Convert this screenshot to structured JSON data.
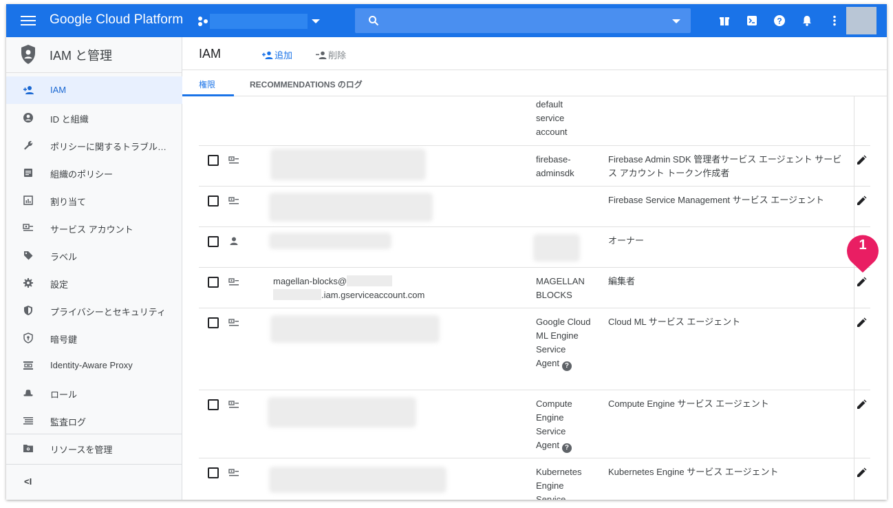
{
  "topbar": {
    "brand": "Google Cloud Platform",
    "icons": [
      "menu-icon",
      "project-icon",
      "search-icon",
      "gift-icon",
      "cloud-shell-icon",
      "help-icon",
      "notifications-icon",
      "more-icon"
    ]
  },
  "sidebar": {
    "title": "IAM と管理",
    "items": [
      {
        "label": "IAM",
        "icon": "add-person-icon",
        "active": true
      },
      {
        "label": "ID と組織",
        "icon": "account-circle-icon"
      },
      {
        "label": "ポリシーに関するトラブル…",
        "icon": "wrench-icon"
      },
      {
        "label": "組織のポリシー",
        "icon": "list-icon"
      },
      {
        "label": "割り当て",
        "icon": "quota-icon"
      },
      {
        "label": "サービス アカウント",
        "icon": "service-account-icon"
      },
      {
        "label": "ラベル",
        "icon": "label-icon"
      },
      {
        "label": "設定",
        "icon": "gear-icon"
      },
      {
        "label": "プライバシーとセキュリティ",
        "icon": "shield-icon"
      },
      {
        "label": "暗号鍵",
        "icon": "key-shield-icon"
      },
      {
        "label": "Identity-Aware Proxy",
        "icon": "proxy-icon"
      },
      {
        "label": "ロール",
        "icon": "hat-icon"
      },
      {
        "label": "監査ログ",
        "icon": "audit-icon"
      }
    ],
    "manage": "リソースを管理",
    "collapse": "<I"
  },
  "main": {
    "title": "IAM",
    "add": "追加",
    "delete": "削除",
    "tabs": [
      "権限",
      "RECOMMENDATIONS のログ"
    ]
  },
  "rows": [
    {
      "name": "default service account",
      "role": ""
    },
    {
      "name": "firebase-adminsdk",
      "role": "Firebase Admin SDK 管理者サービス エージェント サービス アカウント トークン作成者"
    },
    {
      "name": "",
      "role": "Firebase Service Management サービス エージェント"
    },
    {
      "name": "",
      "role": "オーナー"
    },
    {
      "email1": "magellan-blocks@",
      "email2": ".iam.gserviceaccount.com",
      "name": "MAGELLAN BLOCKS",
      "role": "編集者"
    },
    {
      "name": "Google Cloud ML Engine Service Agent",
      "role": "Cloud ML サービス エージェント"
    },
    {
      "name": "Compute Engine Service Agent",
      "role": "Compute Engine サービス エージェント"
    },
    {
      "name": "Kubernetes Engine Service",
      "role": "Kubernetes Engine サービス エージェント"
    }
  ],
  "callout": "1"
}
